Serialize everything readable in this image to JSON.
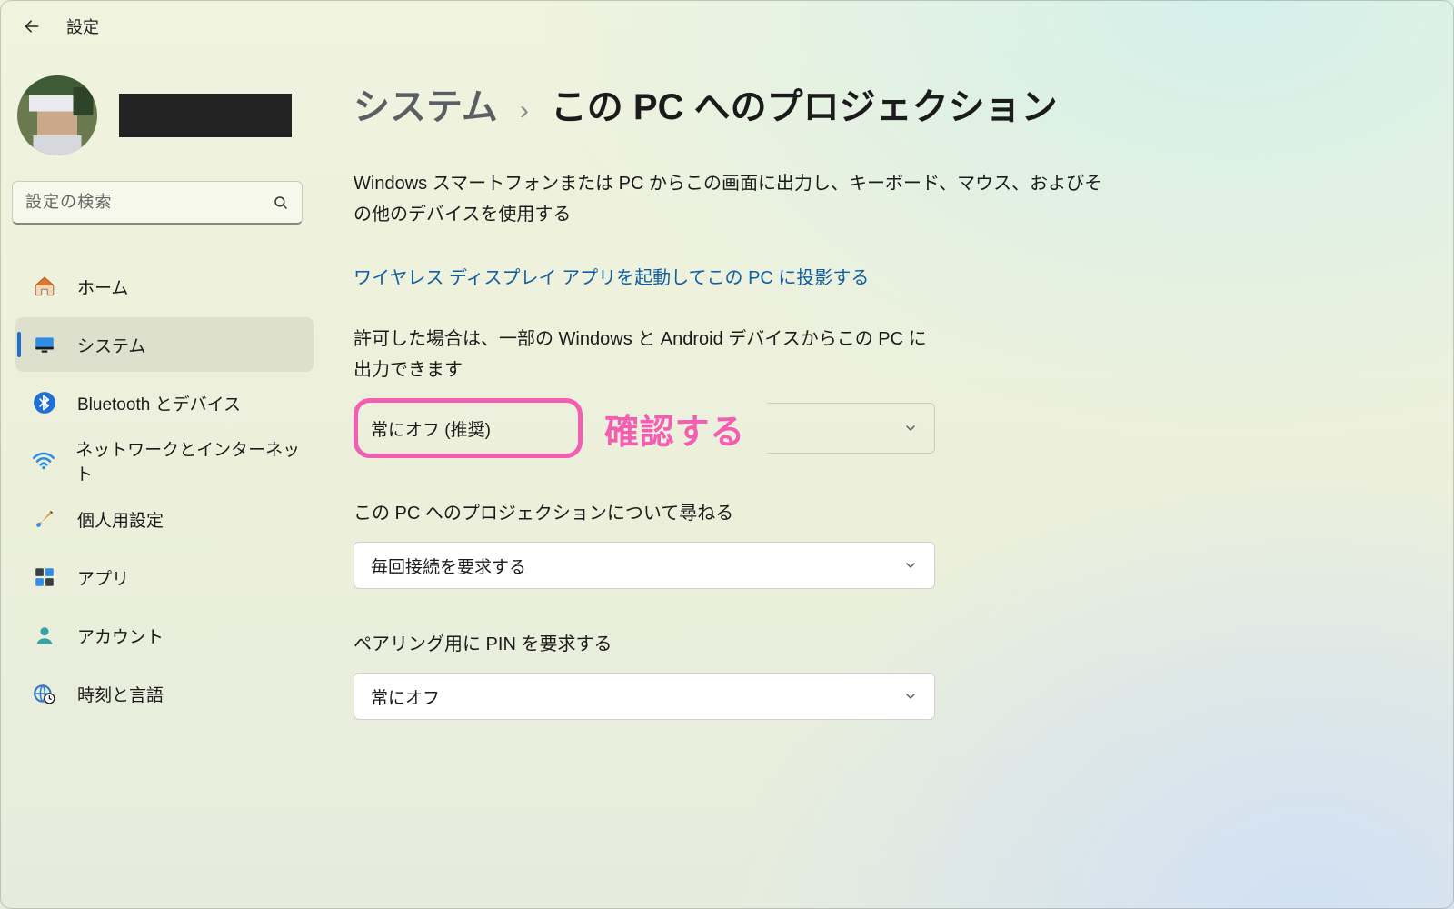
{
  "window": {
    "title": "設定"
  },
  "search": {
    "placeholder": "設定の検索"
  },
  "sidebar": {
    "items": [
      {
        "label": "ホーム"
      },
      {
        "label": "システム"
      },
      {
        "label": "Bluetooth とデバイス"
      },
      {
        "label": "ネットワークとインターネット"
      },
      {
        "label": "個人用設定"
      },
      {
        "label": "アプリ"
      },
      {
        "label": "アカウント"
      },
      {
        "label": "時刻と言語"
      }
    ],
    "active_index": 1
  },
  "breadcrumb": {
    "root": "システム",
    "separator": "›",
    "page": "この PC へのプロジェクション"
  },
  "description": "Windows スマートフォンまたは PC からこの画面に出力し、キーボード、マウス、およびその他のデバイスを使用する",
  "launch_link": "ワイヤレス ディスプレイ アプリを起動してこの PC に投影する",
  "settings": [
    {
      "label": "許可した場合は、一部の Windows と Android デバイスからこの PC に出力できます",
      "value": "常にオフ (推奨)"
    },
    {
      "label": "この PC へのプロジェクションについて尋ねる",
      "value": "毎回接続を要求する"
    },
    {
      "label": "ペアリング用に PIN を要求する",
      "value": "常にオフ"
    }
  ],
  "annotation": {
    "text": "確認する",
    "color": "#f35db2"
  }
}
